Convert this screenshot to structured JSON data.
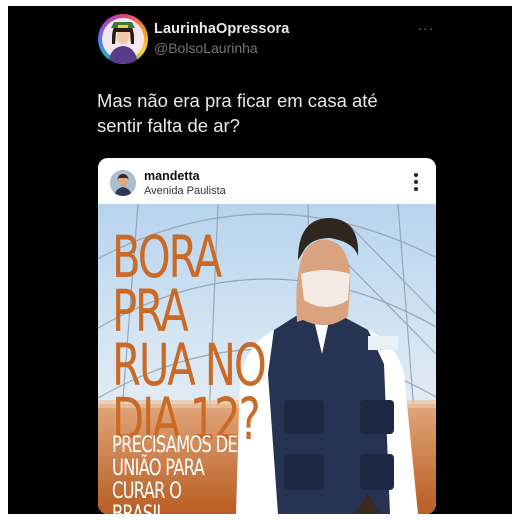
{
  "tweet": {
    "display_name": "LaurinhaOpressora",
    "handle": "@BolsoLaurinha",
    "more_icon": "more-icon",
    "text": "Mas não era pra ficar em casa até sentir falta de ar?"
  },
  "embedded_post": {
    "username": "mandetta",
    "location": "Avenida Paulista",
    "options_icon": "kebab-icon",
    "headline": "BORA PRA\nRUA NO\nDIA 12?",
    "subheadline": "PRECISAMOS DE\nUNIÃO PARA\nCURAR O BRASIL",
    "colors": {
      "headline": "#c96a26",
      "sky": "#b9d6ee",
      "ground": "#c46a2a"
    }
  }
}
